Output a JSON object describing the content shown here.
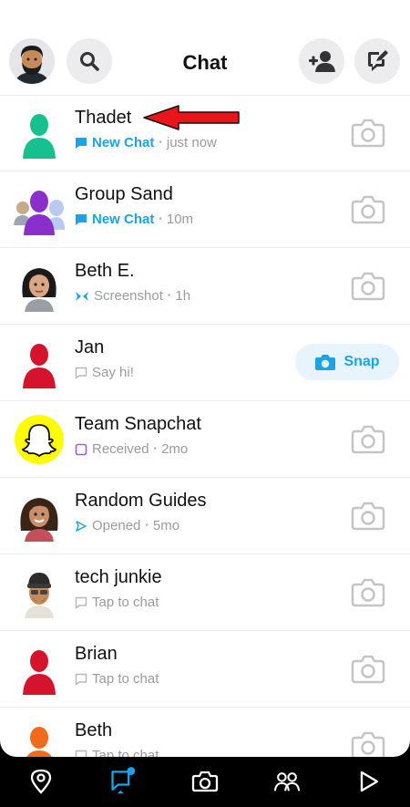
{
  "header": {
    "title": "Chat",
    "icons": {
      "profile": "bitmoji-avatar",
      "search": "search-icon",
      "add_friend": "add-friend-icon",
      "new_chat": "new-chat-icon"
    }
  },
  "chats": [
    {
      "name": "Thadet",
      "status": "New Chat",
      "time": "just now",
      "status_icon": "new-chat-bubble",
      "avatar": "green-silhouette"
    },
    {
      "name": "Group Sand",
      "status": "New Chat",
      "time": "10m",
      "status_icon": "new-chat-bubble",
      "avatar": "group-purple"
    },
    {
      "name": "Beth E.",
      "status": "Screenshot",
      "time": "1h",
      "status_icon": "screenshot-arrows",
      "avatar": "bitmoji-woman"
    },
    {
      "name": "Jan",
      "status": "Say hi!",
      "time": "",
      "status_icon": "chat-outline",
      "avatar": "red-silhouette",
      "action": "Snap"
    },
    {
      "name": "Team Snapchat",
      "status": "Received",
      "time": "2mo",
      "status_icon": "received-square",
      "avatar": "snapchat-ghost"
    },
    {
      "name": "Random Guides",
      "status": "Opened",
      "time": "5mo",
      "status_icon": "opened-arrow",
      "avatar": "bitmoji-woman-2"
    },
    {
      "name": "tech junkie",
      "status": "Tap to chat",
      "time": "",
      "status_icon": "chat-outline",
      "avatar": "bitmoji-man-beanie"
    },
    {
      "name": "Brian",
      "status": "Tap to chat",
      "time": "",
      "status_icon": "chat-outline",
      "avatar": "red-silhouette"
    },
    {
      "name": "Beth",
      "status": "Tap to chat",
      "time": "",
      "status_icon": "chat-outline",
      "avatar": "orange-silhouette"
    }
  ],
  "tabs": [
    "map-icon",
    "chat-icon",
    "camera-icon",
    "friends-icon",
    "discover-icon"
  ],
  "colors": {
    "blue": "#1aa3e8",
    "green": "#16c08f",
    "purple": "#8a2fc9",
    "red": "#d5132c",
    "orange": "#f46a1c",
    "snap_yellow": "#fffc00",
    "arrow_red": "#e8151b"
  }
}
